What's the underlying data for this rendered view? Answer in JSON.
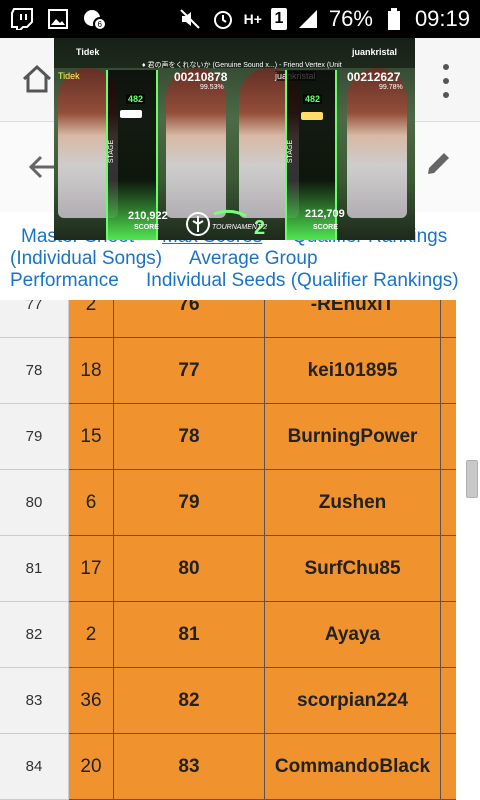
{
  "status_bar": {
    "battery_percent": "76%",
    "time": "09:19",
    "network": "H+",
    "sim": "1",
    "icons_left": [
      "twitch-icon",
      "image-icon",
      "notification-icon"
    ],
    "icons_right": [
      "mute-icon",
      "alarm-icon",
      "network-icon",
      "sim-icon",
      "signal-icon",
      "battery-icon"
    ]
  },
  "browser": {
    "icons": [
      "home-icon",
      "back-icon",
      "edit-icon",
      "more-icon"
    ]
  },
  "nav_links": [
    {
      "label": "Master Sheet"
    },
    {
      "label": "Max Scores"
    },
    {
      "label": "Qualifier Rankings"
    },
    {
      "label": "(Individual Songs)"
    },
    {
      "label": "Average Group"
    },
    {
      "label": "Performance"
    },
    {
      "label": "Individual Seeds (Qualifier Rankings)"
    }
  ],
  "video": {
    "player_left": "Tidek",
    "player_right": "juankristal",
    "song_info": "♦ 君の声をくれないか (Genuine Sound x...) - Friend Vertex (Unity Unlimited Wireframe)",
    "score_left": "00210878",
    "score_right": "00212627",
    "accuracy_left": "99.53%",
    "accuracy_right": "99.78%",
    "combo_left": "482",
    "combo_right": "482",
    "final_score_left": "210,922",
    "final_score_right": "212,709",
    "score_label": "SCORE",
    "stage_label": "STAGE",
    "logo_text": "TOURNAMENT 2"
  },
  "table": {
    "rows": [
      {
        "rank": "77",
        "seed": "2",
        "group": "76",
        "name": "-REnuxIT"
      },
      {
        "rank": "78",
        "seed": "18",
        "group": "77",
        "name": "kei101895"
      },
      {
        "rank": "79",
        "seed": "15",
        "group": "78",
        "name": "BurningPower"
      },
      {
        "rank": "80",
        "seed": "6",
        "group": "79",
        "name": "Zushen"
      },
      {
        "rank": "81",
        "seed": "17",
        "group": "80",
        "name": "SurfChu85"
      },
      {
        "rank": "82",
        "seed": "2",
        "group": "81",
        "name": "Ayaya"
      },
      {
        "rank": "83",
        "seed": "36",
        "group": "82",
        "name": "scorpian224"
      },
      {
        "rank": "84",
        "seed": "20",
        "group": "83",
        "name": "CommandoBlack"
      }
    ]
  },
  "colors": {
    "orange_cell": "#f0922e",
    "link_blue": "#1a73c8",
    "status_bar": "#000000"
  }
}
